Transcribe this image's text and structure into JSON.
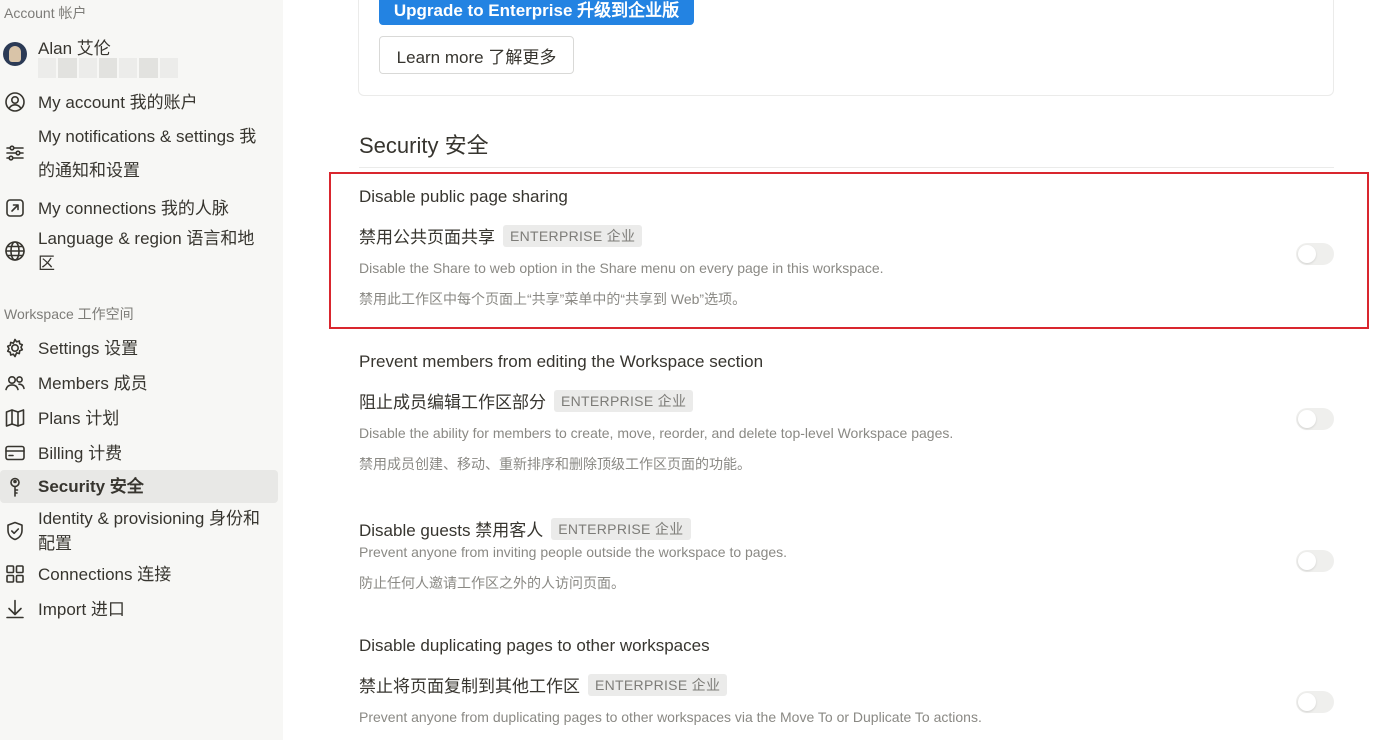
{
  "sidebar": {
    "account_label": "Account 帐户",
    "user_name": "Alan 艾伦",
    "account_items": [
      {
        "label": "My account 我的账户",
        "icon": "user-circle-icon"
      },
      {
        "label": "My notifications & settings 我的通知和设置",
        "icon": "sliders-icon"
      },
      {
        "label": "My connections 我的人脉",
        "icon": "arrow-square-icon"
      },
      {
        "label": "Language & region 语言和地区",
        "icon": "globe-icon"
      }
    ],
    "workspace_label": "Workspace 工作空间",
    "workspace_items": [
      {
        "label": "Settings 设置",
        "icon": "gear-icon"
      },
      {
        "label": "Members 成员",
        "icon": "people-icon"
      },
      {
        "label": "Plans 计划",
        "icon": "map-icon"
      },
      {
        "label": "Billing 计费",
        "icon": "credit-card-icon"
      },
      {
        "label": "Security 安全",
        "icon": "key-icon",
        "active": true
      },
      {
        "label": "Identity & provisioning 身份和配置",
        "icon": "shield-check-icon"
      },
      {
        "label": "Connections 连接",
        "icon": "grid-icon"
      },
      {
        "label": "Import 进口",
        "icon": "download-arrow-icon"
      }
    ]
  },
  "upgrade": {
    "upgrade_label": "Upgrade to Enterprise 升级到企业版",
    "learn_more_label": "Learn more 了解更多"
  },
  "security": {
    "title": "Security 安全",
    "settings": [
      {
        "title_en": "Disable public page sharing",
        "title_zh": "禁用公共页面共享",
        "badge": "ENTERPRISE 企业",
        "desc_en": "Disable the Share to web option in the Share menu on every page in this workspace.",
        "desc_zh": "禁用此工作区中每个页面上“共享”菜单中的“共享到 Web”选项。",
        "enabled": false
      },
      {
        "title_en": "Prevent members from editing the Workspace section",
        "title_zh": "阻止成员编辑工作区部分",
        "badge": "ENTERPRISE 企业",
        "desc_en": "Disable the ability for members to create, move, reorder, and delete top-level Workspace pages.",
        "desc_zh": "禁用成员创建、移动、重新排序和删除顶级工作区页面的功能。",
        "enabled": false
      },
      {
        "title": "Disable guests 禁用客人",
        "badge": "ENTERPRISE 企业",
        "desc_en": "Prevent anyone from inviting people outside the workspace to pages.",
        "desc_zh": "防止任何人邀请工作区之外的人访问页面。",
        "enabled": false
      },
      {
        "title_en": "Disable duplicating pages to other workspaces",
        "title_zh": "禁止将页面复制到其他工作区",
        "badge": "ENTERPRISE 企业",
        "desc_en": "Prevent anyone from duplicating pages to other workspaces via the Move To or Duplicate To actions.",
        "enabled": false
      }
    ]
  },
  "colors": {
    "accent": "#2383e2",
    "highlight": "#d9262e",
    "sidebar_bg": "#f7f7f5"
  }
}
